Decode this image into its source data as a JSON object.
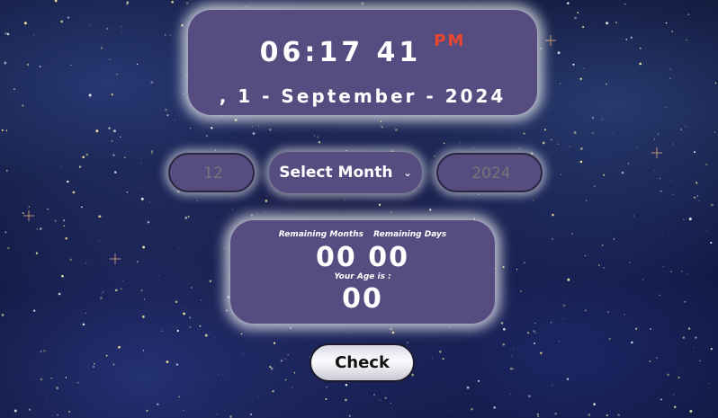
{
  "clock": {
    "time": "06:17 41",
    "ampm": "PM",
    "date": ", 1 - September - 2024"
  },
  "form": {
    "day_placeholder": "12",
    "month_select_label": "Select Month",
    "year_placeholder": "2024"
  },
  "result": {
    "remaining_months_label": "Remaining Months",
    "remaining_days_label": "Remaining Days",
    "remaining_values": "00 00",
    "age_label": "Your Age is :",
    "age_value": "00"
  },
  "check_button_label": "Check",
  "colors": {
    "card_bg": "#564c80",
    "ampm_accent": "#e8462f",
    "sky": "#0d1030"
  }
}
